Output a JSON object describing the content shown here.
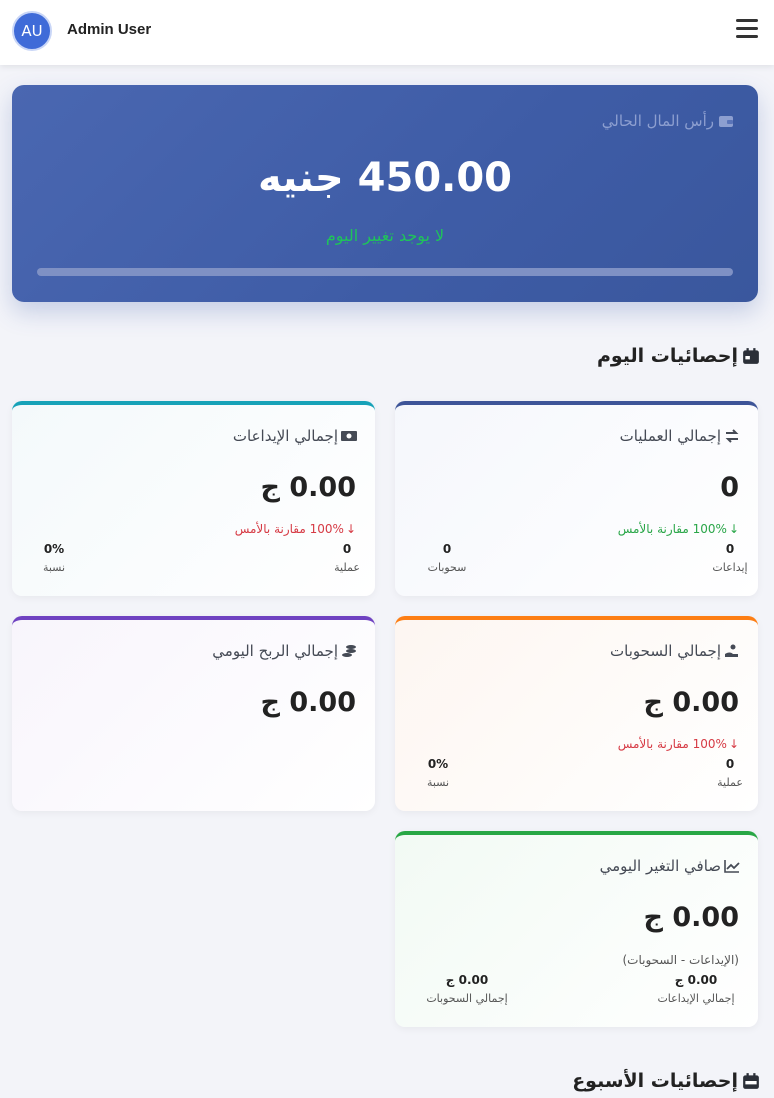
{
  "header": {
    "avatar_initials": "AU",
    "user_name": "Admin User",
    "menu_icon": "hamburger-menu-icon"
  },
  "capital": {
    "label": "رأس المال الحالي",
    "amount": "450.00 جنيه",
    "change_text": "لا يوجد تغيير اليوم",
    "icon": "wallet-icon"
  },
  "today": {
    "title": "إحصائيات اليوم",
    "icon": "calendar-icon",
    "cards": {
      "operations": {
        "title": "إجمالي العمليات",
        "icon": "exchange-arrows-icon",
        "value": "0",
        "compare": "100% مقارنة بالأمس",
        "compare_color": "#2aa648",
        "stat1_value": "0",
        "stat1_label": "إيداعات",
        "stat2_value": "0",
        "stat2_label": "سحوبات",
        "accent": "#3d5498"
      },
      "deposits": {
        "title": "إجمالي الإيداعات",
        "icon": "money-bill-icon",
        "value": "0.00 ج",
        "compare": "100% مقارنة بالأمس",
        "compare_color": "#d63a44",
        "stat1_value": "0",
        "stat1_label": "عملية",
        "stat2_value": "0%",
        "stat2_label": "نسبة",
        "accent": "#17a2b8"
      },
      "withdrawals": {
        "title": "إجمالي السحوبات",
        "icon": "hand-holding-money-icon",
        "value": "0.00 ج",
        "compare": "100% مقارنة بالأمس",
        "compare_color": "#d63a44",
        "stat1_value": "0",
        "stat1_label": "عملية",
        "stat2_value": "0%",
        "stat2_label": "نسبة",
        "accent": "#fd7e14"
      },
      "profit": {
        "title": "إجمالي الربح اليومي",
        "icon": "coins-icon",
        "value": "0.00 ج",
        "accent": "#6f42c1"
      },
      "net": {
        "title": "صافي التغير اليومي",
        "icon": "chart-line-icon",
        "value": "0.00 ج",
        "subtitle": "(الإيداعات - السحوبات)",
        "stat1_value": "0.00 ج",
        "stat1_label": "إجمالي الإيداعات",
        "stat2_value": "0.00 ج",
        "stat2_label": "إجمالي السحوبات",
        "accent": "#28a745"
      }
    }
  },
  "week": {
    "title": "إحصائيات الأسبوع",
    "icon": "calendar-week-icon"
  }
}
